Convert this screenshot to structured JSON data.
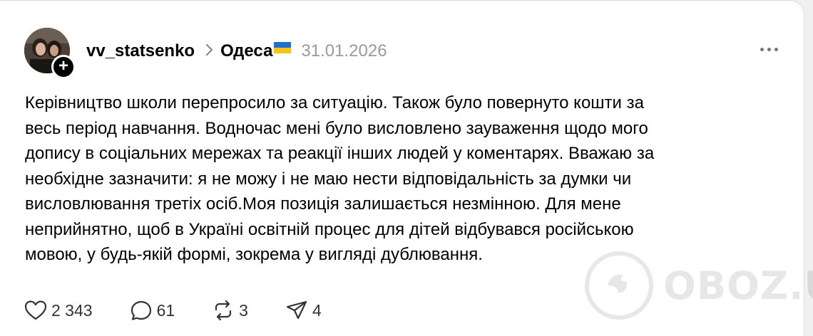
{
  "post": {
    "username": "vv_statsenko",
    "location": "Одеса",
    "date": "31.01.2026",
    "text": [
      "Керівництво школи перепросило за ситуацію. Також було повернуто кошти за",
      "весь період навчання. Водночас мені було висловлено зауваження щодо мого",
      "допису в соціальних мережах та реакції інших людей у коментарях. Вважаю за",
      "необхідне зазначити: я не можу і не маю нести відповідальність за думки чи",
      "висловлювання третіх осіб.Моя позиція залишається незмінною. Для мене",
      "неприйнятно, щоб в Україні освітній процес для дітей відбувався російською",
      "мовою, у будь-якій формі, зокрема у вигляді дублювання."
    ]
  },
  "actions": {
    "likes": "2 343",
    "comments": "61",
    "reposts": "3",
    "shares": "4"
  },
  "icons": {
    "avatar_add": "plus-icon",
    "separator": "chevron-right-icon",
    "location_flag": "ukraine-flag-icon",
    "menu": "more-horizontal-icon",
    "like": "heart-icon",
    "comment": "comment-bubble-icon",
    "repost": "repost-icon",
    "share": "send-icon"
  },
  "colors": {
    "flag_blue": "#1f6fd1",
    "flag_yellow": "#f5c518",
    "date_gray": "#9a9a9a"
  },
  "watermark": {
    "text": "OBOZ.UA"
  }
}
